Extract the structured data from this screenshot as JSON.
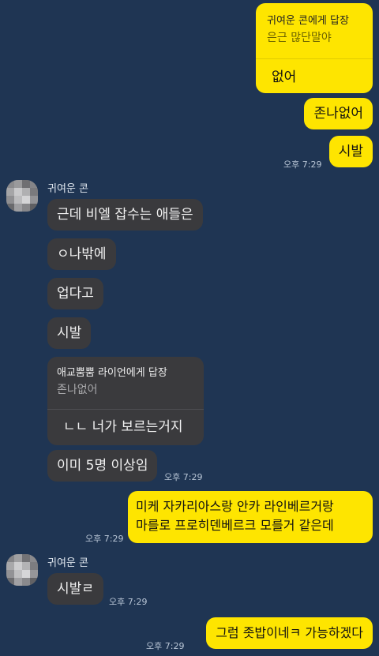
{
  "colors": {
    "background": "#1f3553",
    "my_bubble": "#fee500",
    "their_bubble": "#3a3a3d"
  },
  "messages": {
    "m1": {
      "reply_to": "귀여운 콘에게 답장",
      "quoted": "은근 많단말야",
      "text": "없어"
    },
    "m2": {
      "text": "존나없어"
    },
    "m3": {
      "text": "시발",
      "time": "오후 7:29"
    },
    "sender1": {
      "name": "귀여운 콘",
      "avatar": "avatar-pixelated"
    },
    "m4": {
      "text": "근데 비엘 잡수는 애들은"
    },
    "m5": {
      "text": "ㅇ나밖에"
    },
    "m6": {
      "text": "업다고"
    },
    "m7": {
      "text": "시발"
    },
    "m8": {
      "reply_to": "애교뿜뿜 라이언에게 답장",
      "quoted": "존나없어",
      "text": "ㄴㄴ 너가 보르는거지"
    },
    "m9": {
      "text": "이미 5명 이상임",
      "time": "오후 7:29"
    },
    "m10": {
      "line1": "미케 자카리아스랑 안카 라인베르거랑",
      "line2": "마를로 프로히덴베르크 모를거 같은데",
      "time": "오후 7:29"
    },
    "sender2": {
      "name": "귀여운 콘",
      "avatar": "avatar-pixelated"
    },
    "m11": {
      "text": "시발ㄹ",
      "time": "오후 7:29"
    },
    "m12": {
      "text": "그럼 좃밥이네ㅋ 가능하겠다",
      "time": "오후 7:29"
    }
  }
}
